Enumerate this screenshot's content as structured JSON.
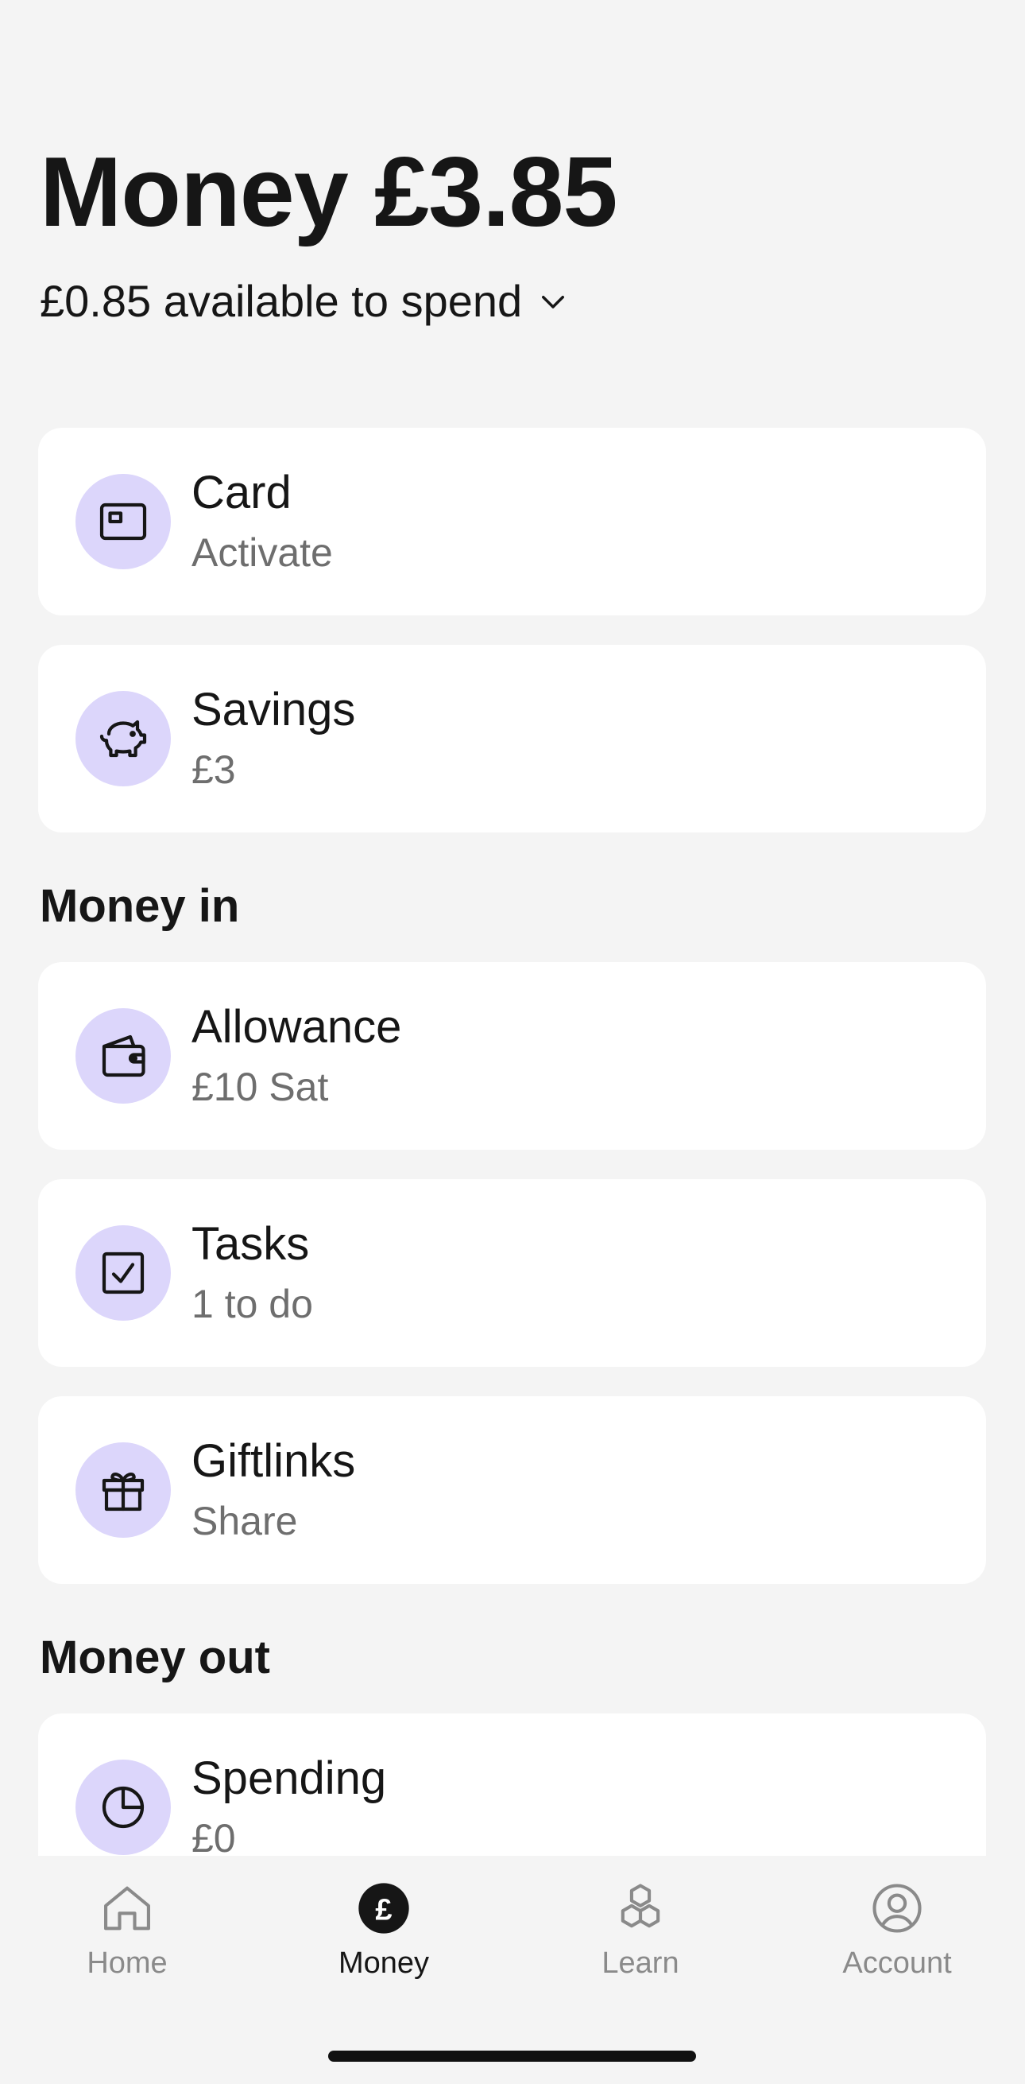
{
  "header": {
    "title": "Money £3.85",
    "subtitle": "£0.85 available to spend"
  },
  "cards": [
    {
      "title": "Card",
      "subtitle": "Activate",
      "icon": "card-icon"
    },
    {
      "title": "Savings",
      "subtitle": "£3",
      "icon": "piggy-bank-icon"
    },
    {
      "title": "Allowance",
      "subtitle": "£10 Sat",
      "icon": "wallet-icon"
    },
    {
      "title": "Tasks",
      "subtitle": "1 to do",
      "icon": "checkbox-icon"
    },
    {
      "title": "Giftlinks",
      "subtitle": "Share",
      "icon": "gift-icon"
    },
    {
      "title": "Spending",
      "subtitle": "£0",
      "icon": "pie-chart-icon"
    }
  ],
  "sections": {
    "money_in": "Money in",
    "money_out": "Money out"
  },
  "tabs": [
    {
      "label": "Home",
      "icon": "home-icon"
    },
    {
      "label": "Money",
      "icon": "pound-icon",
      "active": true
    },
    {
      "label": "Learn",
      "icon": "hexagons-icon"
    },
    {
      "label": "Account",
      "icon": "account-icon"
    }
  ],
  "colors": {
    "background": "#f4f4f4",
    "icon_circle": "#dcd6fb",
    "text_primary": "#161616",
    "text_secondary": "#6e6e6e"
  }
}
